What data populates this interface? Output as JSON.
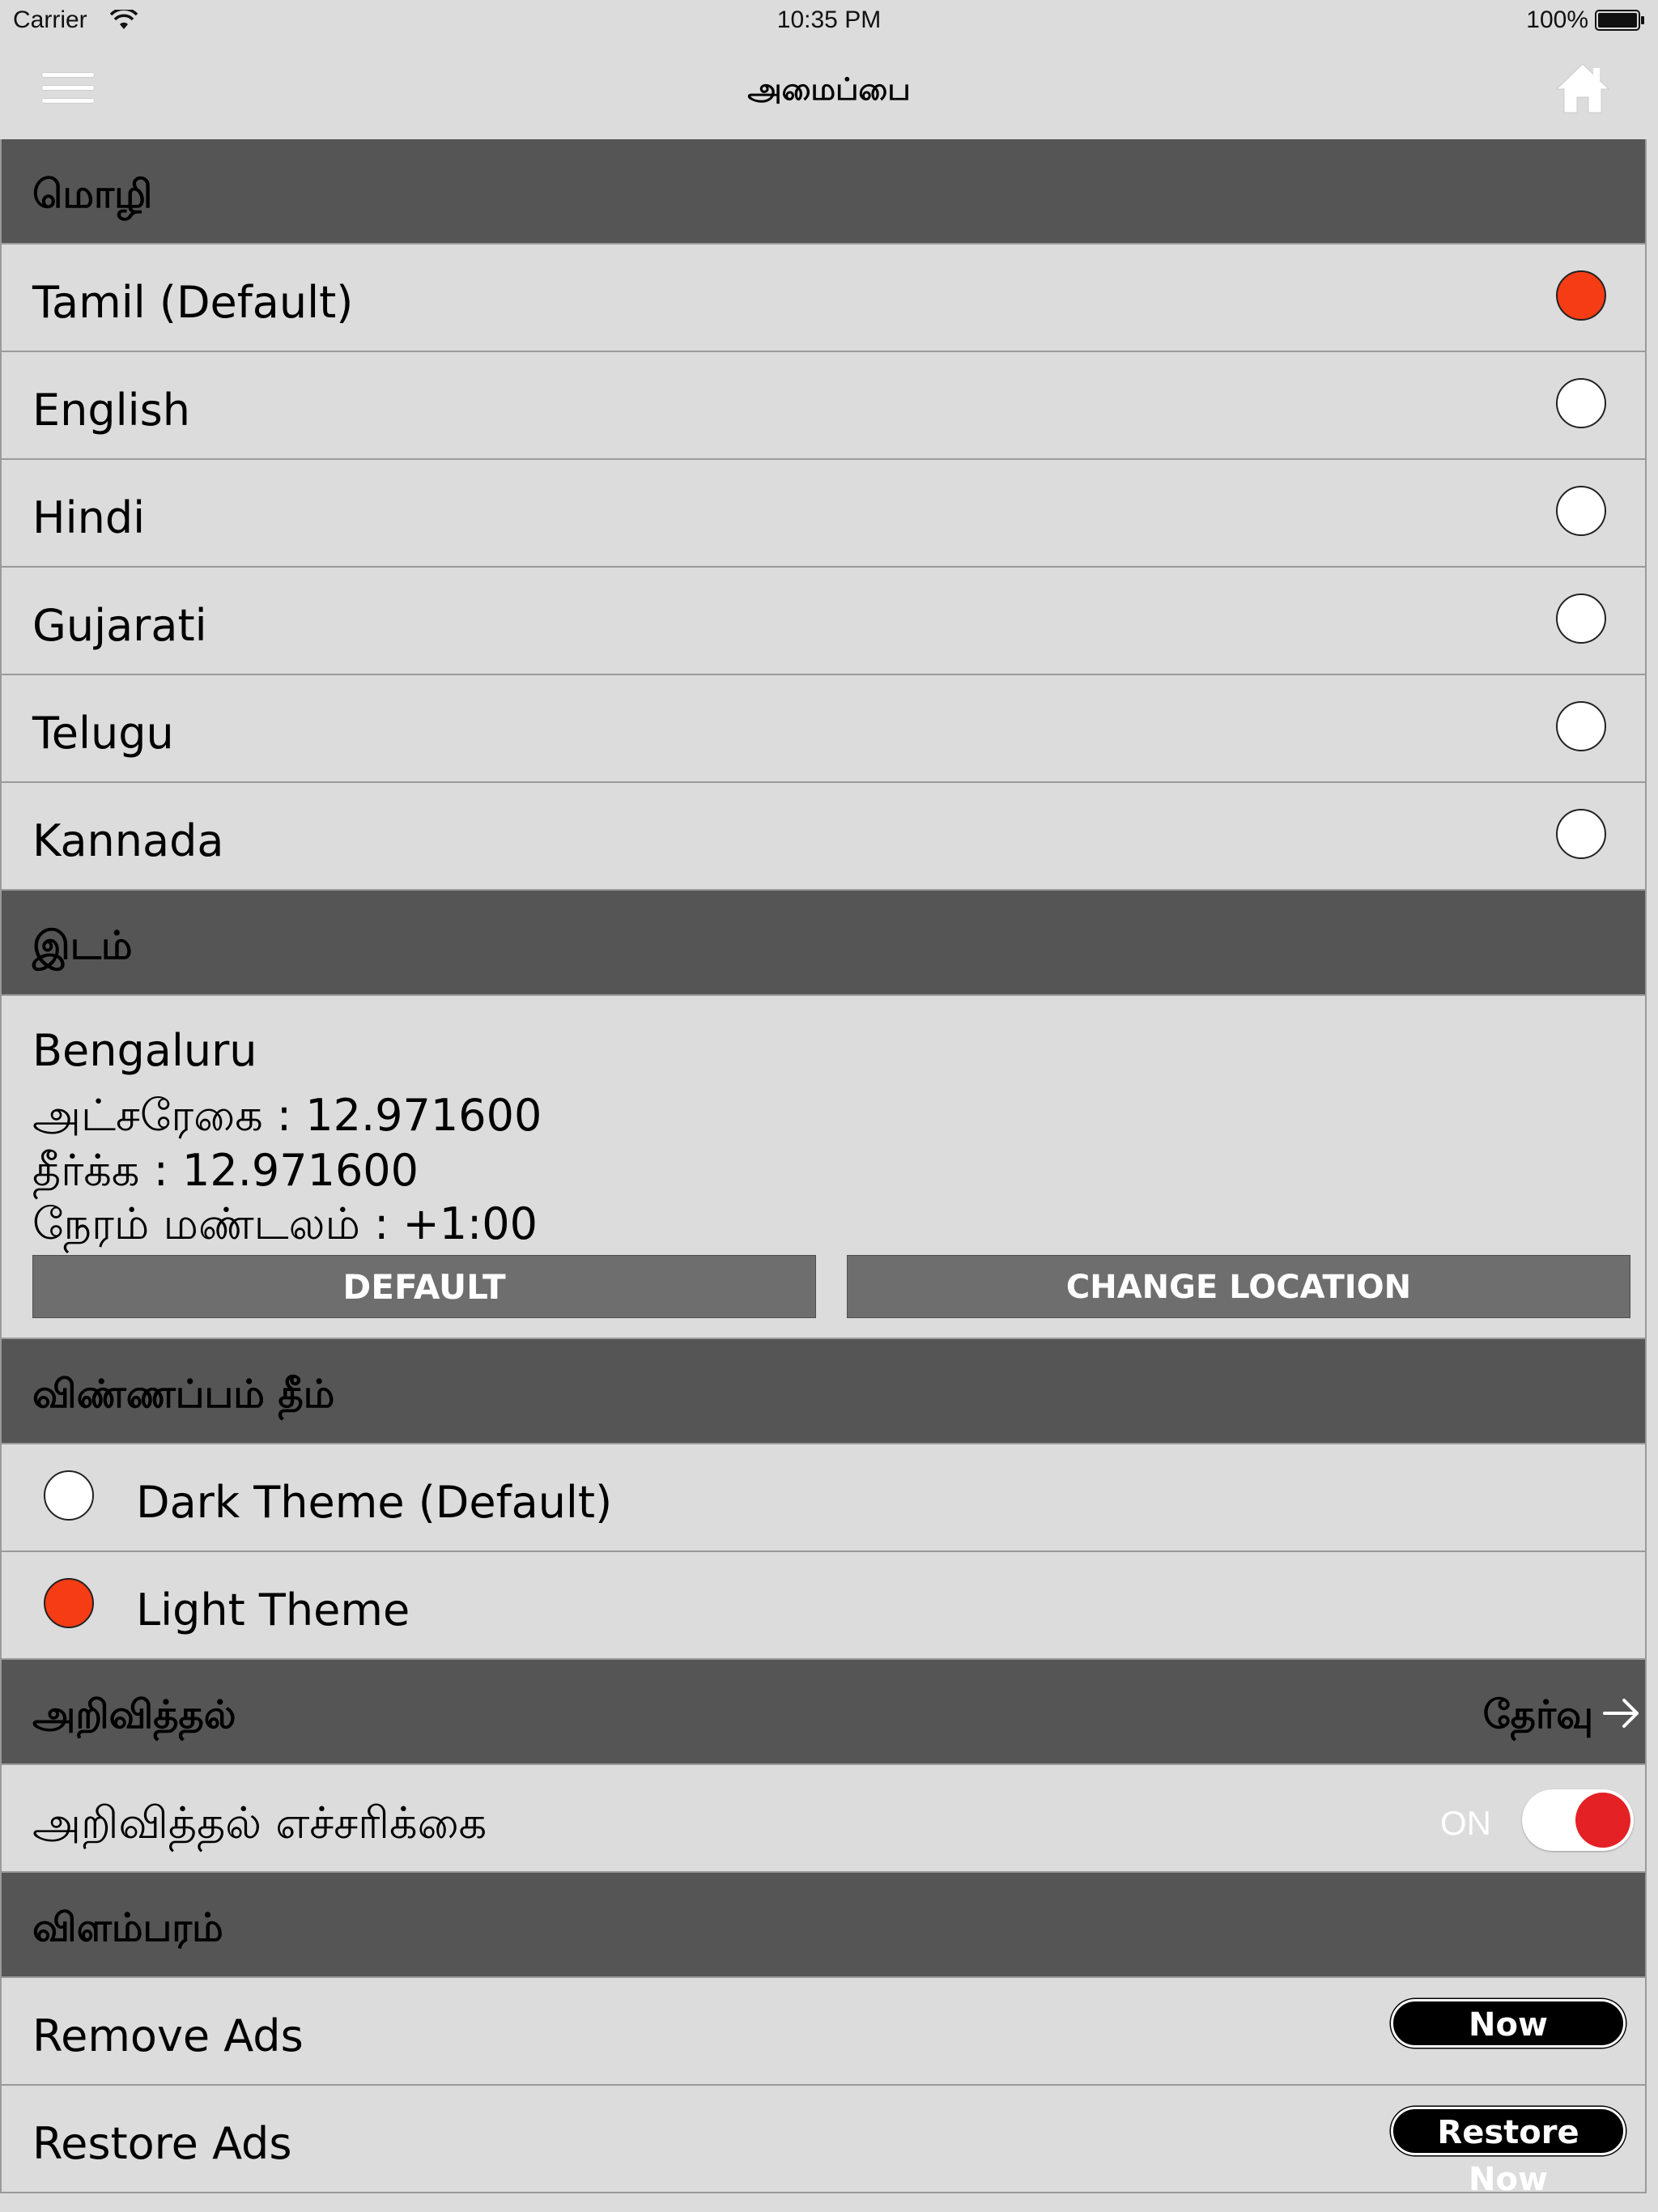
{
  "status_bar": {
    "carrier": "Carrier",
    "time": "10:35 PM",
    "battery": "100%"
  },
  "nav": {
    "title": "அமைப்பை",
    "menu_icon": "hamburger-menu-icon",
    "home_icon": "home-icon"
  },
  "language": {
    "header": "மொழி",
    "options": [
      {
        "label": "Tamil (Default)",
        "selected": true
      },
      {
        "label": "English",
        "selected": false
      },
      {
        "label": "Hindi",
        "selected": false
      },
      {
        "label": "Gujarati",
        "selected": false
      },
      {
        "label": "Telugu",
        "selected": false
      },
      {
        "label": "Kannada",
        "selected": false
      }
    ]
  },
  "location": {
    "header": "இடம்",
    "city": "Bengaluru",
    "latitude_line": "அட்சரேகை : 12.971600",
    "longitude_line": "தீர்க்க : 12.971600",
    "timezone_line": "நேரம் மண்டலம் : +1:00",
    "default_button": "DEFAULT",
    "change_button": "CHANGE LOCATION"
  },
  "theme": {
    "header": "விண்ணப்பம் தீம்",
    "options": [
      {
        "label": "Dark Theme (Default)",
        "selected": false
      },
      {
        "label": "Light Theme",
        "selected": true
      }
    ]
  },
  "notification": {
    "header": "அறிவித்தல்",
    "action_label": "தேர்வு",
    "alert_label": "அறிவித்தல் எச்சரிக்கை",
    "toggle_text": "ON",
    "toggle_on": true
  },
  "ads": {
    "header": "விளம்பரம்",
    "remove_label": "Remove Ads",
    "remove_button": "Now",
    "restore_label": "Restore Ads",
    "restore_button": "Restore Now"
  },
  "colors": {
    "selected_radio": "#f63c14",
    "toggle_knob": "#e42124",
    "section_header": "#555555",
    "background": "#dcdcdc"
  }
}
